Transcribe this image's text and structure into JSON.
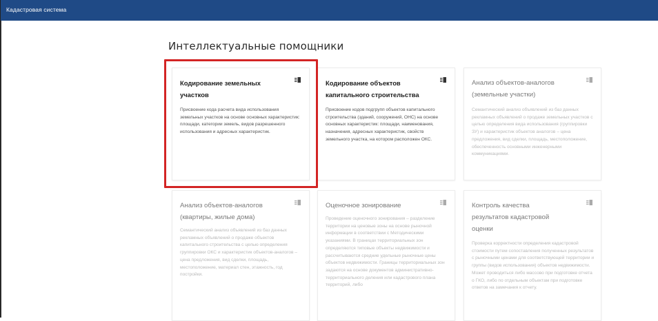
{
  "header": {
    "brand": "Кадастровая система",
    "bg_color": "#1f4a86"
  },
  "page": {
    "title": "Интеллектуальные помощники"
  },
  "highlight_color": "#d32424",
  "cards": [
    {
      "title": "Кодирование земельных участков",
      "description": "Присвоение кода расчета вида использования земельных участков на основе основных характеристик: площади, категории земель, видов разрешенного использования и адресных характеристик.",
      "icon": "book-icon",
      "active": true
    },
    {
      "title": "Кодирование объектов капитального строительства",
      "description": "Присвоение кодов подгрупп объектов капитального строительства (зданий, сооружений, ОНС) на основе основных характеристик: площади, наименования, назначения, адресных характеристик, свойств земельного участка, на котором расположен ОКС.",
      "icon": "book-icon",
      "active": true
    },
    {
      "title": "Анализ объектов-аналогов (земельные участки)",
      "description": "Семантический анализ объявлений из баз данных рекламных объявлений о продаже земельных участков с целью определения вида использования (группировки ЗУ) и характеристик объектов аналогов – цена предложения, вид сделки, площадь, местоположение, обеспеченность основными инженерными коммуникациями.",
      "icon": "book-icon",
      "active": false
    },
    {
      "title": "Анализ объектов-аналогов (квартиры, жилые дома)",
      "description": "Семантический анализ объявлений из баз данных рекламных объявлений о продаже объектов капитального строительства с целью определения группировки ОКС и характеристик объектов-аналогов – цена предложения, вид сделки, площадь, местоположение, материал стен, этажность, год постройки.",
      "icon": "book-icon",
      "active": false
    },
    {
      "title": "Оценочное зонирование",
      "description": "Проведение оценочного зонирования – разделение территории на ценовые зоны на основе рыночной информации в соответствии с Методическими указаниями. В границах территориальных зон определяются типовые объекты недвижимости и рассчитываются средние удельные рыночные цены объектов недвижимости. Границы территориальных зон задаются на основе документов административно-территориального деления или кадастрового плана территорий, либо",
      "icon": "book-icon",
      "active": false
    },
    {
      "title": "Контроль качества результатов кадастровой оценки",
      "description": "Проверка корректности определения кадастровой стоимости путем сопоставления полученных результатов с рыночными ценами для соответствующей территории и группы (видов использования) объектов недвижимости. Может проводиться либо массово при подготовке отчета о ГКО, либо по отдельным объектам при подготовке ответов на замечания к отчету.",
      "icon": "book-icon",
      "active": false
    }
  ]
}
